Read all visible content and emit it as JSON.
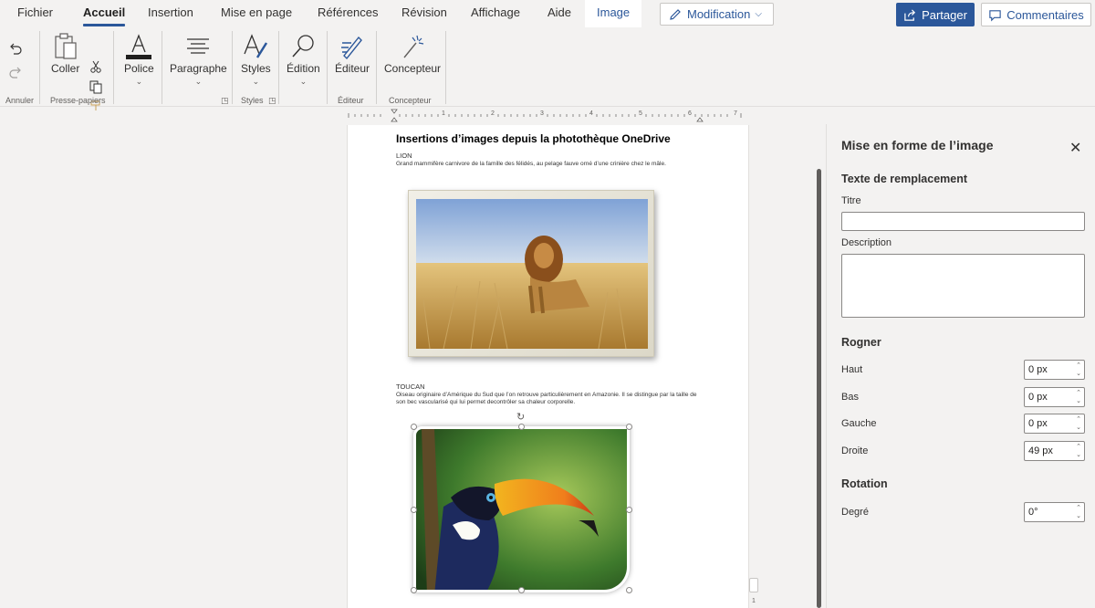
{
  "menu": {
    "tabs": [
      "Fichier",
      "Accueil",
      "Insertion",
      "Mise en page",
      "Références",
      "Révision",
      "Affichage",
      "Aide",
      "Image"
    ],
    "active_tab": "Accueil",
    "contextual_tab": "Image",
    "mode_button": "Modification",
    "share_button": "Partager",
    "comments_button": "Commentaires"
  },
  "ribbon": {
    "coller": "Coller",
    "police": "Police",
    "paragraphe": "Paragraphe",
    "styles": "Styles",
    "edition": "Édition",
    "editeur": "Éditeur",
    "concepteur": "Concepteur",
    "groups": {
      "annuler": "Annuler",
      "presse_papiers": "Presse-papiers",
      "styles": "Styles",
      "editeur": "Éditeur",
      "concepteur": "Concepteur"
    }
  },
  "ruler": {
    "numbers": [
      "1",
      "2",
      "3",
      "4",
      "5",
      "6",
      "7"
    ]
  },
  "document": {
    "title": "Insertions d’images depuis la photothèque OneDrive",
    "lion_heading": "LION",
    "lion_text": "Grand mammifère carnivore de la famille des félidés, au pelage fauve orné d’une crinière chez le mâle.",
    "toucan_heading": "TOUCAN",
    "toucan_text": "Oiseau originaire d’Amérique du Sud que l’on retrouve particulièrement en Amazonie. Il se distingue par la taille de son bec vascularisé qui lui permet decontrôler sa chaleur corporelle.",
    "page_number": "1"
  },
  "pane": {
    "title": "Mise en forme de l’image",
    "alt_text_section": "Texte de remplacement",
    "titre_label": "Titre",
    "titre_value": "",
    "description_label": "Description",
    "description_value": "",
    "crop_section": "Rogner",
    "haut_label": "Haut",
    "haut_value": "0 px",
    "bas_label": "Bas",
    "bas_value": "0 px",
    "gauche_label": "Gauche",
    "gauche_value": "0 px",
    "droite_label": "Droite",
    "droite_value": "49 px",
    "rotation_section": "Rotation",
    "degre_label": "Degré",
    "degre_value": "0°"
  },
  "colors": {
    "accent": "#2b579a",
    "ribbon_bg": "#f3f2f1"
  },
  "icons": [
    "undo-icon",
    "redo-icon",
    "paste-icon",
    "cut-icon",
    "copy-icon",
    "format-painter-icon",
    "font-color-icon",
    "paragraph-icon",
    "styles-icon",
    "search-icon",
    "editor-icon",
    "designer-icon",
    "pencil-icon",
    "share-icon",
    "comment-icon",
    "close-icon"
  ]
}
